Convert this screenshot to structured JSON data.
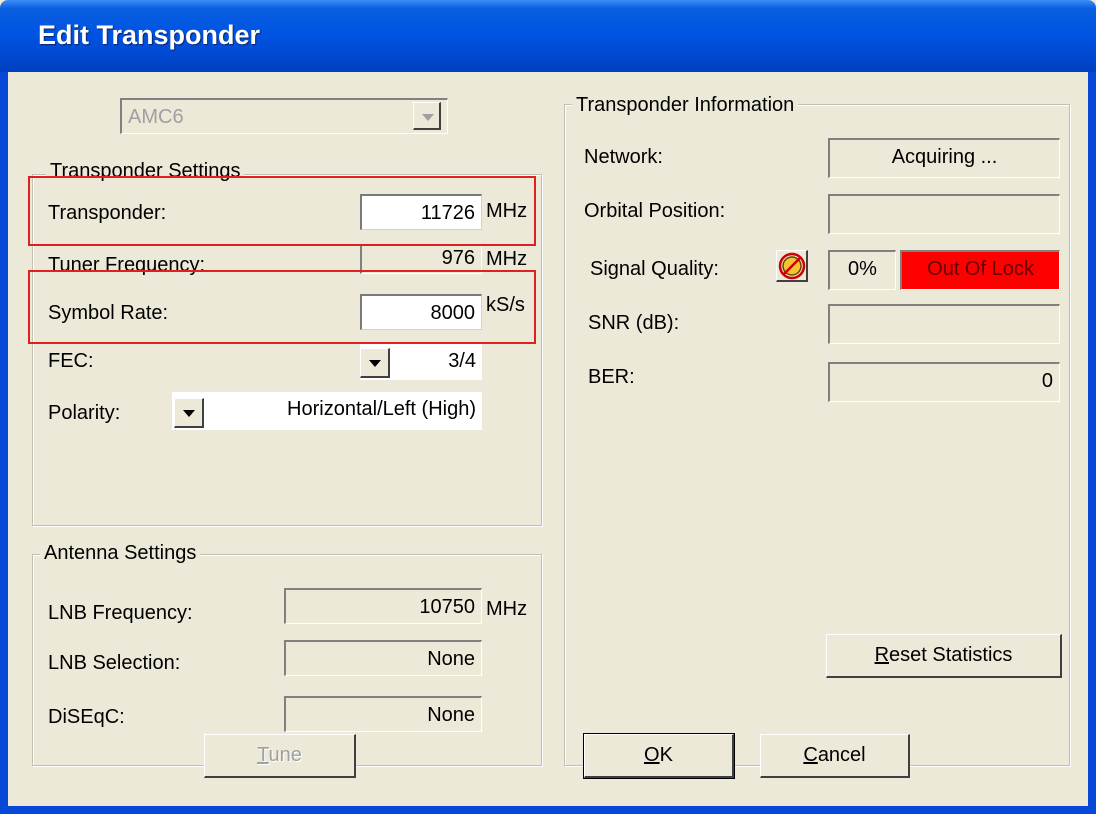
{
  "window": {
    "title": "Edit Transponder"
  },
  "satellite_select": {
    "value": "AMC6"
  },
  "transponder_settings": {
    "legend": "Transponder Settings",
    "transponder": {
      "label": "Transponder:",
      "value": "11726",
      "unit": "MHz"
    },
    "tuner_frequency": {
      "label": "Tuner Frequency:",
      "value": "976",
      "unit": "MHz"
    },
    "symbol_rate": {
      "label": "Symbol Rate:",
      "value": "8000",
      "unit": "kS/s"
    },
    "fec": {
      "label": "FEC:",
      "value": "3/4"
    },
    "polarity": {
      "label": "Polarity:",
      "value": "Horizontal/Left (High)"
    }
  },
  "antenna_settings": {
    "legend": "Antenna Settings",
    "lnb_frequency": {
      "label": "LNB Frequency:",
      "value": "10750",
      "unit": "MHz"
    },
    "lnb_selection": {
      "label": "LNB Selection:",
      "value": "None"
    },
    "diseqc": {
      "label": "DiSEqC:",
      "value": "None"
    }
  },
  "transponder_info": {
    "legend": "Transponder Information",
    "network": {
      "label": "Network:",
      "value": "Acquiring ..."
    },
    "orbital_position": {
      "label": "Orbital Position:",
      "value": ""
    },
    "signal_quality": {
      "label": "Signal Quality:",
      "percent": "0%",
      "status": "Out Of Lock",
      "status_color": "#ff0000"
    },
    "snr": {
      "label": "SNR (dB):",
      "value": ""
    },
    "ber": {
      "label": "BER:",
      "value": "0"
    },
    "reset_button": {
      "label_u": "R",
      "label_rest": "eset Statistics"
    }
  },
  "buttons": {
    "tune": {
      "label_u": "T",
      "label_rest": "une"
    },
    "ok": {
      "label_u": "O",
      "label_rest": "K"
    },
    "cancel": {
      "label_u": "C",
      "label_rest": "ancel"
    }
  }
}
